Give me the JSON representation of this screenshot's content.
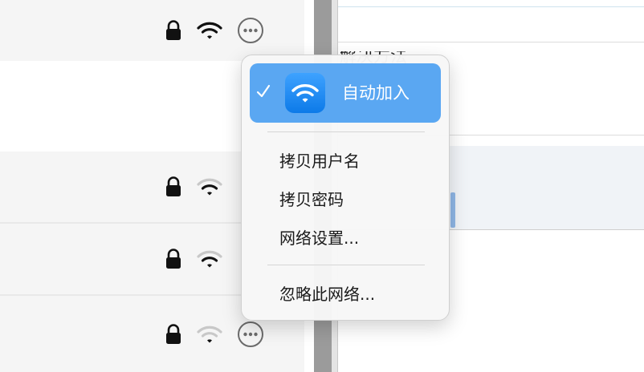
{
  "background_text": "解决方法",
  "networks": [
    {
      "secured": true,
      "signal": "strong",
      "has_more_button": true
    },
    {
      "secured": true,
      "signal": "medium",
      "has_more_button": false
    },
    {
      "secured": true,
      "signal": "medium",
      "has_more_button": false
    },
    {
      "secured": true,
      "signal": "weak",
      "has_more_button": true
    }
  ],
  "context_menu": {
    "selected_item": {
      "label": "自动加入",
      "checked": true,
      "icon": "wifi-icon"
    },
    "items_group_1": [
      {
        "label": "拷贝用户名"
      },
      {
        "label": "拷贝密码"
      },
      {
        "label": "网络设置..."
      }
    ],
    "items_group_2": [
      {
        "label": "忽略此网络..."
      }
    ]
  },
  "colors": {
    "menu_highlight": "#5aa7f2",
    "app_icon": "#1a88f0",
    "row_background": "#f5f5f5"
  }
}
